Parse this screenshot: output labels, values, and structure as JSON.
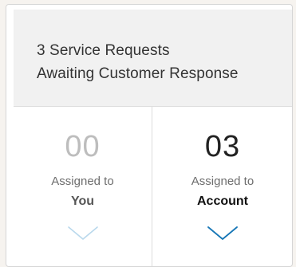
{
  "header": {
    "title_line1": "3 Service Requests",
    "title_line2": "Awaiting Customer Response"
  },
  "stats": [
    {
      "count": "00",
      "assigned_label": "Assigned to",
      "target": "You",
      "chevron_icon": "chevron-down-icon",
      "chevron_color": "#b9d8ec"
    },
    {
      "count": "03",
      "assigned_label": "Assigned to",
      "target": "Account",
      "chevron_icon": "chevron-down-icon",
      "chevron_color": "#1676b6"
    }
  ]
}
